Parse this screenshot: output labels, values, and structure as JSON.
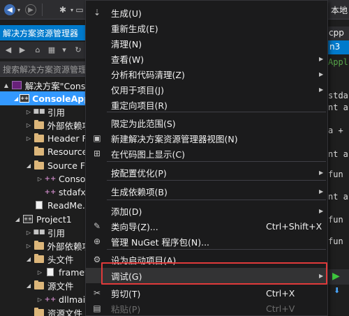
{
  "toolbar": {
    "right_text": "本地"
  },
  "solution_explorer": {
    "title": "解决方案资源管理器",
    "search_placeholder": "搜索解决方案资源管理",
    "tree": [
      {
        "label": "解决方案\"Conso",
        "indent": 0,
        "icon": "solution",
        "arrow": "▲",
        "selected": false
      },
      {
        "label": "ConsoleAppl",
        "indent": 1,
        "icon": "project",
        "arrow": "◢",
        "selected": true
      },
      {
        "label": "引用",
        "indent": 2,
        "icon": "ref",
        "arrow": "▷",
        "selected": false
      },
      {
        "label": "外部依赖项",
        "indent": 2,
        "icon": "folder",
        "arrow": "▷",
        "selected": false
      },
      {
        "label": "Header Fi",
        "indent": 2,
        "icon": "folder",
        "arrow": "▷",
        "selected": false
      },
      {
        "label": "Resource",
        "indent": 2,
        "icon": "folder",
        "arrow": "",
        "selected": false
      },
      {
        "label": "Source Fil",
        "indent": 2,
        "icon": "folder",
        "arrow": "◢",
        "selected": false
      },
      {
        "label": "Conso",
        "indent": 3,
        "icon": "cpp",
        "arrow": "▷",
        "selected": false
      },
      {
        "label": "stdafx.",
        "indent": 3,
        "icon": "cpp",
        "arrow": "",
        "selected": false
      },
      {
        "label": "ReadMe.t",
        "indent": 2,
        "icon": "file",
        "arrow": "",
        "selected": false
      },
      {
        "label": "Project1",
        "indent": 1,
        "icon": "project",
        "arrow": "◢",
        "selected": false
      },
      {
        "label": "引用",
        "indent": 2,
        "icon": "ref",
        "arrow": "▷",
        "selected": false
      },
      {
        "label": "外部依赖项",
        "indent": 2,
        "icon": "folder",
        "arrow": "▷",
        "selected": false
      },
      {
        "label": "头文件",
        "indent": 2,
        "icon": "folder",
        "arrow": "◢",
        "selected": false
      },
      {
        "label": "framev",
        "indent": 3,
        "icon": "file",
        "arrow": "▷",
        "selected": false
      },
      {
        "label": "源文件",
        "indent": 2,
        "icon": "folder",
        "arrow": "◢",
        "selected": false
      },
      {
        "label": "dllmair",
        "indent": 3,
        "icon": "cpp",
        "arrow": "▷",
        "selected": false
      },
      {
        "label": "资源文件",
        "indent": 2,
        "icon": "folder",
        "arrow": "",
        "selected": false
      }
    ]
  },
  "editor": {
    "tab_cpp": "cpp",
    "tab_active": "n3",
    "lines": [
      "Appl",
      "stda",
      "nt a",
      "a +",
      "nt a",
      "fun",
      "nt a",
      "fun",
      "fun"
    ]
  },
  "context_menu": {
    "items": [
      {
        "label": "生成(U)",
        "icon": "build-icon",
        "glyph": "⇣",
        "shortcut": "",
        "arrow": false,
        "disabled": false,
        "sep_before": false
      },
      {
        "label": "重新生成(E)",
        "icon": "",
        "glyph": "",
        "shortcut": "",
        "arrow": false,
        "disabled": false,
        "sep_before": false
      },
      {
        "label": "清理(N)",
        "icon": "",
        "glyph": "",
        "shortcut": "",
        "arrow": false,
        "disabled": false,
        "sep_before": false
      },
      {
        "label": "查看(W)",
        "icon": "",
        "glyph": "",
        "shortcut": "",
        "arrow": true,
        "disabled": false,
        "sep_before": false
      },
      {
        "label": "分析和代码清理(Z)",
        "icon": "",
        "glyph": "",
        "shortcut": "",
        "arrow": true,
        "disabled": false,
        "sep_before": false
      },
      {
        "label": "仅用于项目(J)",
        "icon": "",
        "glyph": "",
        "shortcut": "",
        "arrow": true,
        "disabled": false,
        "sep_before": false
      },
      {
        "label": "重定向项目(R)",
        "icon": "",
        "glyph": "",
        "shortcut": "",
        "arrow": false,
        "disabled": false,
        "sep_before": false
      },
      {
        "label": "限定为此范围(S)",
        "icon": "",
        "glyph": "",
        "shortcut": "",
        "arrow": false,
        "disabled": false,
        "sep_before": true
      },
      {
        "label": "新建解决方案资源管理器视图(N)",
        "icon": "new-view-icon",
        "glyph": "▣",
        "shortcut": "",
        "arrow": false,
        "disabled": false,
        "sep_before": false
      },
      {
        "label": "在代码图上显示(C)",
        "icon": "code-map-icon",
        "glyph": "⊞",
        "shortcut": "",
        "arrow": false,
        "disabled": false,
        "sep_before": false
      },
      {
        "label": "按配置优化(P)",
        "icon": "",
        "glyph": "",
        "shortcut": "",
        "arrow": true,
        "disabled": false,
        "sep_before": true
      },
      {
        "label": "生成依赖项(B)",
        "icon": "",
        "glyph": "",
        "shortcut": "",
        "arrow": true,
        "disabled": false,
        "sep_before": true
      },
      {
        "label": "添加(D)",
        "icon": "",
        "glyph": "",
        "shortcut": "",
        "arrow": true,
        "disabled": false,
        "sep_before": true
      },
      {
        "label": "类向导(Z)...",
        "icon": "class-wizard-icon",
        "glyph": "✎",
        "shortcut": "Ctrl+Shift+X",
        "arrow": false,
        "disabled": false,
        "sep_before": false
      },
      {
        "label": "管理 NuGet 程序包(N)...",
        "icon": "nuget-icon",
        "glyph": "⊕",
        "shortcut": "",
        "arrow": false,
        "disabled": false,
        "sep_before": false
      },
      {
        "label": "设为启动项目(A)",
        "icon": "gear-icon",
        "glyph": "⚙",
        "shortcut": "",
        "arrow": false,
        "disabled": false,
        "sep_before": true
      },
      {
        "label": "调试(G)",
        "icon": "",
        "glyph": "",
        "shortcut": "",
        "arrow": true,
        "disabled": false,
        "sep_before": false
      },
      {
        "label": "剪切(T)",
        "icon": "scissors-icon",
        "glyph": "✂",
        "shortcut": "Ctrl+X",
        "arrow": false,
        "disabled": false,
        "sep_before": true
      },
      {
        "label": "粘贴(P)",
        "icon": "paste-icon",
        "glyph": "▤",
        "shortcut": "Ctrl+V",
        "arrow": false,
        "disabled": true,
        "sep_before": false
      }
    ]
  }
}
